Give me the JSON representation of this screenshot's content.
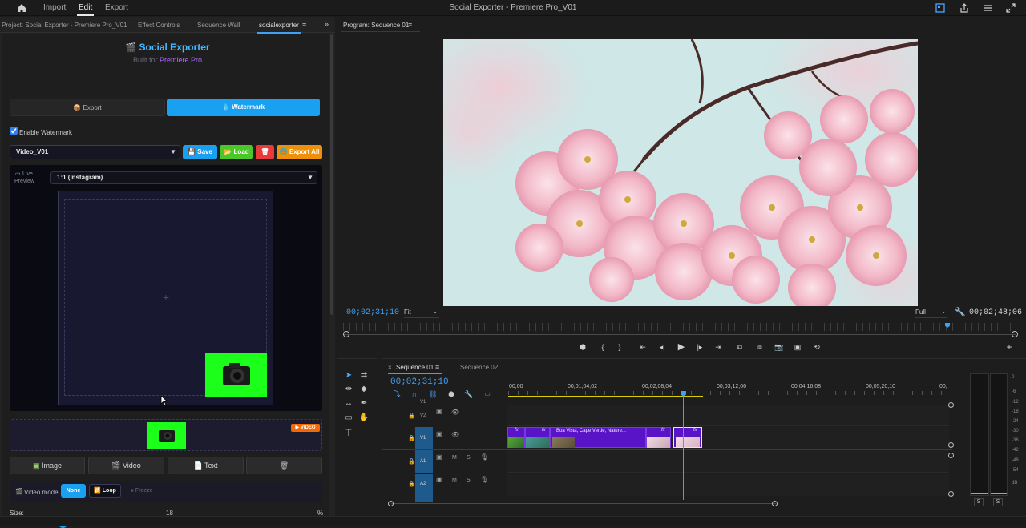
{
  "topbar": {
    "nav": [
      "Import",
      "Edit",
      "Export"
    ],
    "active": "Edit",
    "title": "Social Exporter - Premiere Pro_V01"
  },
  "left_tabs": {
    "project": "Project: Social Exporter - Premiere Pro_V01",
    "effect_controls": "Effect Controls",
    "sequence_wall": "Sequence Wall",
    "extension": "socialexporter"
  },
  "extension": {
    "title": "Social Exporter",
    "built_for_prefix": "Built for ",
    "built_for_app": "Premiere Pro",
    "tabs": {
      "export": "Export",
      "watermark": "Watermark"
    },
    "enable_watermark": "Enable Watermark",
    "preset_select": "Video_V01",
    "buttons": {
      "save": "Save",
      "load": "Load",
      "export_all": "Export All"
    },
    "live_preview": "Live Preview",
    "aspect_select": "1:1 (Instagram)",
    "video_badge": "VIDEO",
    "media_buttons": {
      "image": "Image",
      "video": "Video",
      "text": "Text"
    },
    "video_mode_label": "Video mode:",
    "video_modes": {
      "none": "None",
      "loop": "Loop",
      "freeze": "Freeze"
    },
    "size_label": "Size:",
    "size_value": "18",
    "size_unit": "%",
    "size_fraction": 0.17
  },
  "program": {
    "title": "Program: Sequence 01",
    "current_tc": "00;02;31;10",
    "fit": "Fit",
    "quality": "Full",
    "duration_tc": "00;02;48;06"
  },
  "timeline": {
    "tabs": [
      "Sequence 01",
      "Sequence 02"
    ],
    "current_tc": "00;02;31;10",
    "ruler": [
      "00;00",
      "00;01;04;02",
      "00;02;08;04",
      "00;03;12;06",
      "00;04;16;08",
      "00;05;20;10",
      "00;"
    ],
    "tracks": [
      "V2",
      "V1",
      "A1",
      "A2"
    ],
    "clip_title": "Boa Vista, Cape Verde, Nature...",
    "fx": "fx",
    "track_m": "M",
    "track_s": "S"
  },
  "meters": {
    "db": [
      "0",
      "-6",
      "-12",
      "-18",
      "-24",
      "-30",
      "-36",
      "-42",
      "-48",
      "-54",
      "dB"
    ],
    "solo": "S"
  },
  "colors": {
    "accent_blue": "#1aa0f0",
    "save": "#1aa0f0",
    "load": "#4cc72a",
    "delete": "#e83a3a",
    "export_all": "#f0900a",
    "green_screen": "#1bff1b",
    "clip_purple": "#5a14c8",
    "timecode": "#3ea1f5"
  }
}
